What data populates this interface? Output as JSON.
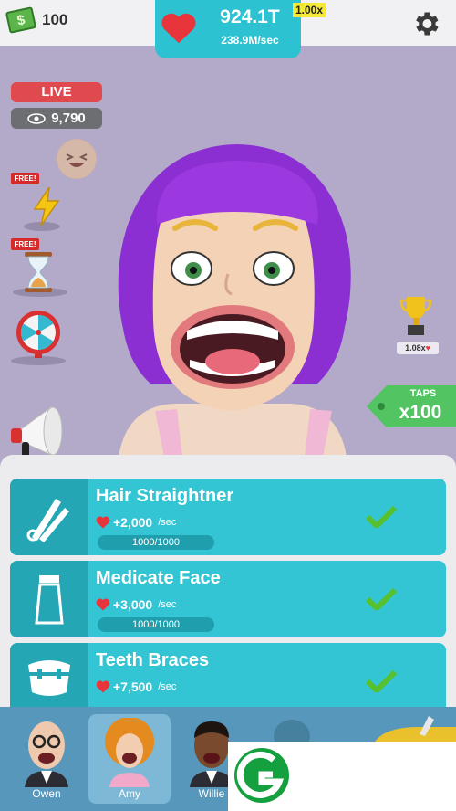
{
  "hud": {
    "cash_value": "100",
    "hearts_total": "924.1T",
    "hearts_rate": "238.9M/sec",
    "multiplier": "1.00x",
    "icons": {
      "cash": "money-bill-icon",
      "hearts": "heart-icon",
      "settings": "gear-icon"
    }
  },
  "stream": {
    "live_label": "LIVE",
    "viewers": "9,790"
  },
  "boosts": {
    "free_label": "FREE!",
    "items": [
      "laughing-face-icon",
      "lightning-bolt-icon",
      "hourglass-icon",
      "prize-wheel-icon"
    ]
  },
  "side": {
    "trophy_multiplier": "1.08x",
    "taps_label": "TAPS",
    "taps_count": "x100"
  },
  "upgrades": [
    {
      "title": "Hair Straightner",
      "rate": "+2,000",
      "unit": "/sec",
      "progress": "1000/1000",
      "icon": "hair-straightener-icon",
      "completed": true
    },
    {
      "title": "Medicate Face",
      "rate": "+3,000",
      "unit": "/sec",
      "progress": "1000/1000",
      "icon": "cream-tube-icon",
      "completed": true
    },
    {
      "title": "Teeth Braces",
      "rate": "+7,500",
      "unit": "/sec",
      "progress": "",
      "icon": "braces-icon",
      "completed": true
    }
  ],
  "patients": [
    {
      "name": "Owen",
      "selected": false
    },
    {
      "name": "Amy",
      "selected": true
    },
    {
      "name": "Willie",
      "selected": false
    }
  ],
  "colors": {
    "background": "#b3a9c8",
    "accent": "#2dc2d2",
    "card": "#34c5d4",
    "live": "#e04a4e",
    "heart": "#e8343b",
    "check": "#57c02e",
    "taps": "#52c462"
  }
}
